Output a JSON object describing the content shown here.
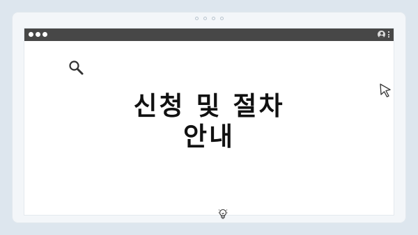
{
  "headline": {
    "line1": "신청 및 절차",
    "line2": "안내"
  },
  "icons": {
    "search": "search-icon",
    "cursor": "cursor-icon",
    "bulb": "lightbulb-icon",
    "profile": "profile-icon",
    "menu": "kebab-menu-icon"
  },
  "colors": {
    "background": "#dde6ee",
    "frame": "#f3f6f9",
    "titlebar": "#474747",
    "window": "#ffffff",
    "text": "#111111"
  }
}
